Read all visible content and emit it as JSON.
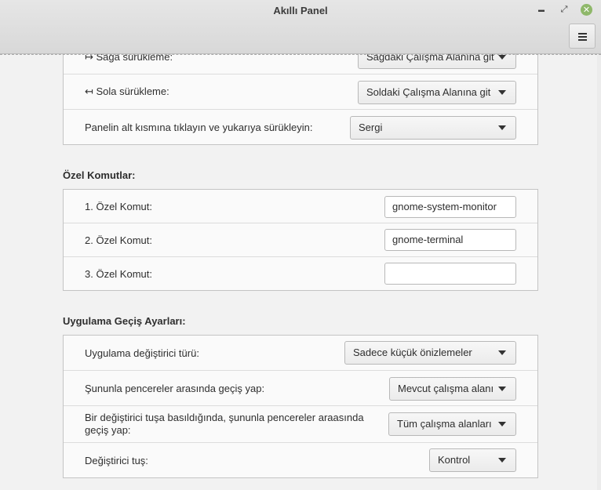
{
  "window": {
    "title": "Akıllı Panel",
    "minimize_glyph": "▬",
    "maximize_glyph": "⤢",
    "close_glyph": "✕"
  },
  "drag_section": {
    "rows": [
      {
        "label": "↦ Sağa sürükleme:",
        "value": "Sağdaki Çalışma Alanına git"
      },
      {
        "label": "↤ Sola sürükleme:",
        "value": "Soldaki Çalışma Alanına git"
      },
      {
        "label": "Panelin alt kısmına tıklayın ve yukarıya sürükleyin:",
        "value": "Sergi"
      }
    ]
  },
  "custom_commands": {
    "title": "Özel Komutlar:",
    "rows": [
      {
        "label": "1. Özel Komut:",
        "value": "gnome-system-monitor"
      },
      {
        "label": "2. Özel Komut:",
        "value": "gnome-terminal"
      },
      {
        "label": "3. Özel Komut:",
        "value": ""
      }
    ]
  },
  "app_switch": {
    "title": "Uygulama Geçiş Ayarları:",
    "rows": [
      {
        "label": "Uygulama değiştirici türü:",
        "value": "Sadece küçük önizlemeler"
      },
      {
        "label": "Şununla pencereler arasında geçiş yap:",
        "value": "Mevcut çalışma alanı"
      },
      {
        "label": "Bir değiştirici tuşa basıldığında, şununla pencereler araasında geçiş yap:",
        "value": "Tüm çalışma alanları"
      },
      {
        "label": "Değiştirici tuş:",
        "value": "Kontrol"
      }
    ]
  },
  "colors": {
    "background": "#f2f2f2",
    "close_button": "#8fb86a"
  }
}
